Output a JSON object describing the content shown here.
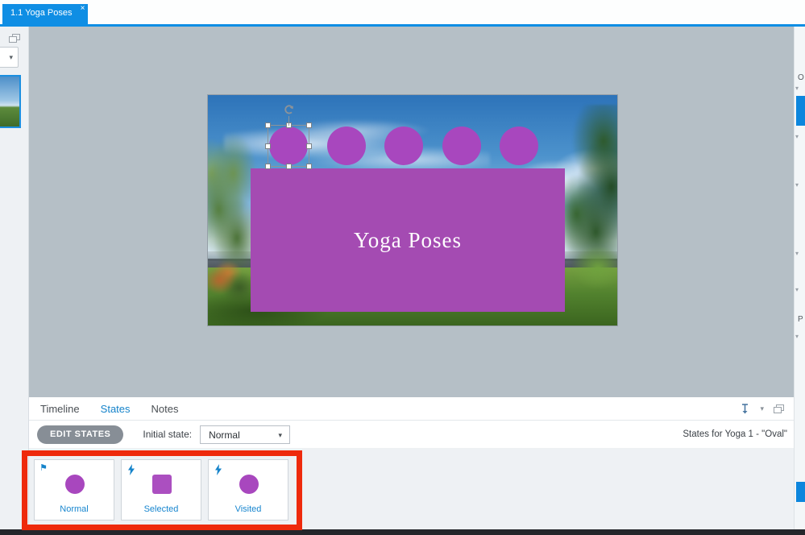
{
  "tab_bar": {
    "tab_label": "1.1 Yoga Poses",
    "close_glyph": "×"
  },
  "sidebar": {
    "caret_glyph": "▾"
  },
  "slide": {
    "title": "Yoga Poses"
  },
  "bottom_panel": {
    "tabs": {
      "timeline": "Timeline",
      "states": "States",
      "notes": "Notes"
    },
    "edit_states": "EDIT STATES",
    "initial_state_label": "Initial state:",
    "initial_state_value": "Normal",
    "context_label": "States for Yoga 1  - \"Oval\"",
    "states": [
      {
        "name": "Normal"
      },
      {
        "name": "Selected"
      },
      {
        "name": "Visited"
      }
    ]
  },
  "right_panel": {
    "letter_top": "O",
    "letter_mid": "P",
    "caret_glyph": "▾"
  },
  "icons": {
    "caret": "▾",
    "flag": "⚑"
  },
  "colors": {
    "accent_blue": "#0f8ee4",
    "shape_purple": "#a847be",
    "annotation_red": "#ee2a0c",
    "label_blue": "#1886cf",
    "canvas_gray": "#b5bfc6"
  }
}
